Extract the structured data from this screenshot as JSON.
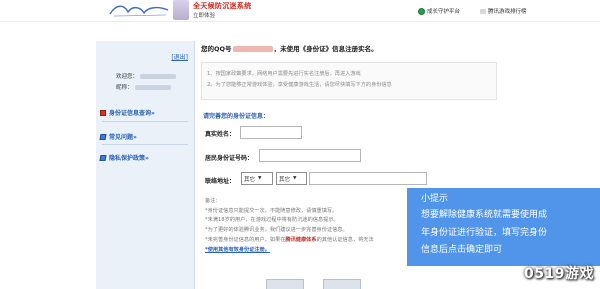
{
  "topbar": {
    "brand_title": "全天候防沉迷系统",
    "brand_sub": "立即体验",
    "links": [
      "成长守护平台",
      "腾讯游戏排行榜"
    ]
  },
  "sidebar": {
    "logout": "[退出]",
    "welcome_label": "欢迎您：",
    "nickname_label": "昵称：",
    "menu": [
      "身份证信息查询»",
      "常见问题»",
      "隐私保护政策»"
    ]
  },
  "main": {
    "greeting_prefix": "您的QQ号",
    "greeting_suffix": "，未使用《身份证》信息注册实名。",
    "notices": [
      "1、按国家政策要求，网络用户需要先进行实名注册后，再进入游戏",
      "2、为了您能够正常游戏体验，享受健康游戏生活，请您尽快填写下方的身份信息"
    ],
    "section_title": "请完善您的身份证信息：",
    "fields": {
      "name_label": "真实姓名：",
      "id_label": "居民身份证号码：",
      "address_label": "联络地址："
    },
    "address_selects": [
      "其它",
      "其它"
    ],
    "remarks_heading": "备注：",
    "remarks": [
      "*身份证信息只能提交一次，不能随意修改，请慎重填写。",
      "*未满18岁的用户，在游戏过程中将有防沉迷的信息提示。",
      "*为了更好的体验腾讯业务，我们建议进一步完善身份证信息。",
      "*未完善身份证信息的用户，如果在"
    ],
    "remark_red": "腾讯健康体系",
    "remark_tail": "的其他认证信息，将无法",
    "remark_link": "*使用其他有效身份证注册。"
  },
  "tooltip": {
    "title": "小提示",
    "lines": [
      "想要解除健康系统就需要使用成",
      "年身份证进行验证，填写完身份",
      "信息后点击确定即可"
    ]
  },
  "watermark": "0519游戏"
}
